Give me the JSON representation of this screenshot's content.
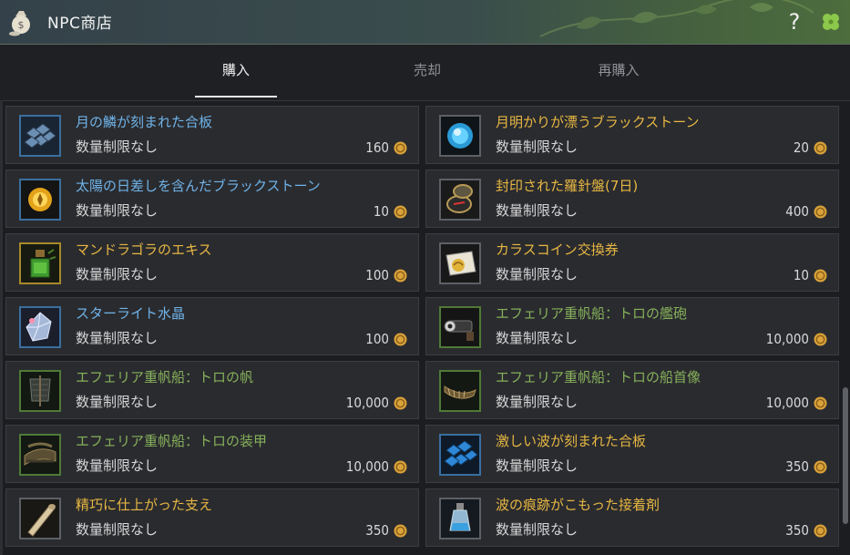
{
  "window": {
    "title": "NPC商店"
  },
  "header": {
    "help_symbol": "?"
  },
  "tabs": [
    {
      "label": "購入",
      "active": true
    },
    {
      "label": "売却",
      "active": false
    },
    {
      "label": "再購入",
      "active": false
    }
  ],
  "items": [
    {
      "name": "月の鱗が刻まれた合板",
      "limit": "数量制限なし",
      "price": "160",
      "name_color": "blue",
      "icon": "blue-scale-plate-icon"
    },
    {
      "name": "月明かりが漂うブラックストーン",
      "limit": "数量制限なし",
      "price": "20",
      "name_color": "gold",
      "icon": "moonlight-blackstone-icon"
    },
    {
      "name": "太陽の日差しを含んだブラックストーン",
      "limit": "数量制限なし",
      "price": "10",
      "name_color": "blue",
      "icon": "sunlight-blackstone-icon"
    },
    {
      "name": "封印された羅針盤(7日)",
      "limit": "数量制限なし",
      "price": "400",
      "name_color": "gold",
      "icon": "compass-icon"
    },
    {
      "name": "マンドラゴラのエキス",
      "limit": "数量制限なし",
      "price": "100",
      "name_color": "gold",
      "icon": "mandragora-essence-icon"
    },
    {
      "name": "カラスコイン交換券",
      "limit": "数量制限なし",
      "price": "10",
      "name_color": "gold",
      "icon": "crow-coin-voucher-icon"
    },
    {
      "name": "スターライト水晶",
      "limit": "数量制限なし",
      "price": "100",
      "name_color": "blue",
      "icon": "starlight-crystal-icon"
    },
    {
      "name": "エフェリア重帆船：トロの艦砲",
      "limit": "数量制限なし",
      "price": "10,000",
      "name_color": "green",
      "icon": "ship-cannon-icon"
    },
    {
      "name": "エフェリア重帆船：トロの帆",
      "limit": "数量制限なし",
      "price": "10,000",
      "name_color": "green",
      "icon": "ship-sail-icon"
    },
    {
      "name": "エフェリア重帆船：トロの船首像",
      "limit": "数量制限なし",
      "price": "10,000",
      "name_color": "green",
      "icon": "ship-figurehead-icon"
    },
    {
      "name": "エフェリア重帆船：トロの装甲",
      "limit": "数量制限なし",
      "price": "10,000",
      "name_color": "green",
      "icon": "ship-armor-icon"
    },
    {
      "name": "激しい波が刻まれた合板",
      "limit": "数量制限なし",
      "price": "350",
      "name_color": "gold",
      "icon": "wave-plate-icon"
    },
    {
      "name": "精巧に仕上がった支え",
      "limit": "数量制限なし",
      "price": "350",
      "name_color": "gold",
      "icon": "timber-support-icon"
    },
    {
      "name": "波の痕跡がこもった接着剤",
      "limit": "数量制限なし",
      "price": "350",
      "name_color": "gold",
      "icon": "adhesive-bottle-icon"
    }
  ],
  "colors": {
    "name_blue": "#6fb3e8",
    "name_gold": "#e7b742",
    "name_green": "#86b15a",
    "coin": "#d9a23a"
  }
}
